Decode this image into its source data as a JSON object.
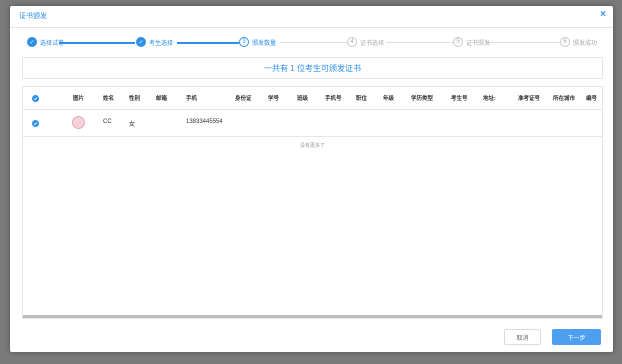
{
  "dialog": {
    "title": "证书颁发",
    "close_symbol": "×"
  },
  "steps": [
    {
      "label": "选择试卷",
      "status": "done",
      "marker": "✓"
    },
    {
      "label": "考生选择",
      "status": "done",
      "marker": "✓"
    },
    {
      "label": "颁发数量",
      "status": "active",
      "marker": "3"
    },
    {
      "label": "证书选择",
      "status": "todo",
      "marker": "4"
    },
    {
      "label": "证书颁发",
      "status": "todo",
      "marker": "5"
    },
    {
      "label": "颁发成功",
      "status": "todo",
      "marker": "6"
    }
  ],
  "banner": {
    "text": "一共有 1 位考生可颁发证书"
  },
  "table": {
    "columns": [
      "图片",
      "姓名",
      "性别",
      "邮箱",
      "手机",
      "身份证",
      "学号",
      "班级",
      "手机号",
      "职位",
      "年级",
      "学历类型",
      "考生号",
      "地址:",
      "准考证号",
      "所在城市",
      "编号"
    ],
    "rows": [
      {
        "name": "CC",
        "gender": "女",
        "email": "",
        "phone": "13833445554"
      }
    ],
    "empty_text": "没有更多了"
  },
  "buttons": {
    "cancel": "取消",
    "next": "下一步"
  },
  "colors": {
    "accent": "#2f8fe6",
    "button": "#4d9ff0",
    "overlay": "#7a7a7a"
  }
}
